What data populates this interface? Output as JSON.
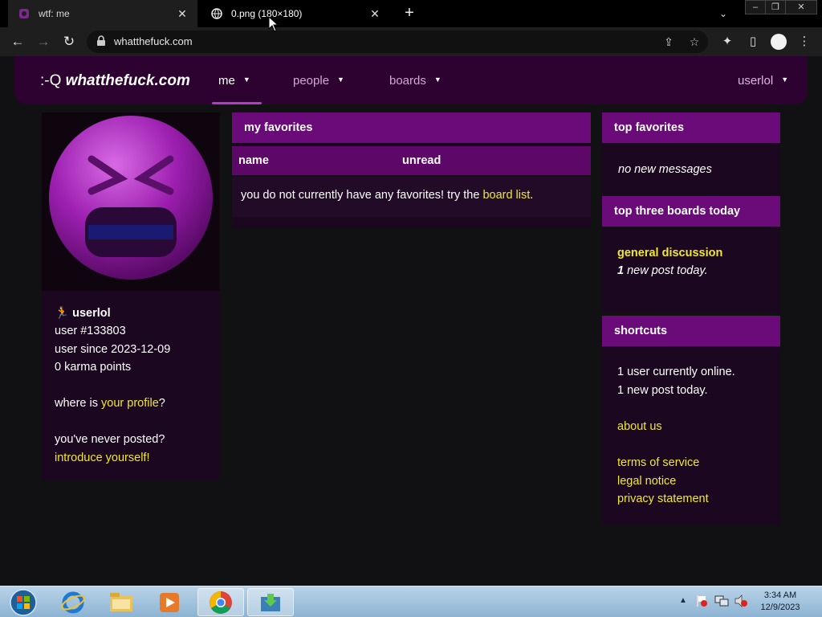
{
  "browser": {
    "tabs": [
      {
        "title": "wtf: me",
        "active": false
      },
      {
        "title": "0.png (180×180)",
        "active": true
      }
    ],
    "new_tab": "+",
    "url": "whatthefuck.com"
  },
  "site": {
    "logo_prefix": ":-Q",
    "logo_name": "whatthefuck.com",
    "nav": [
      {
        "label": "me"
      },
      {
        "label": "people"
      },
      {
        "label": "boards"
      }
    ],
    "user_menu": "userlol"
  },
  "profile": {
    "username": "userlol",
    "user_number": "user #133803",
    "user_since": "user since 2023-12-09",
    "karma": "0 karma points",
    "where_prefix": "where is ",
    "where_link": "your profile",
    "where_suffix": "?",
    "never_posted": "you've never posted?",
    "introduce_link": "introduce yourself!"
  },
  "favorites": {
    "title": "my favorites",
    "col_name": "name",
    "col_unread": "unread",
    "empty_prefix": "you do not currently have any favorites! try the ",
    "empty_link": "board list",
    "empty_suffix": "."
  },
  "top_favorites": {
    "title": "top favorites",
    "empty": "no new messages"
  },
  "top_boards": {
    "title": "top three boards today",
    "board_name": "general discussion",
    "count": "1",
    "count_suffix": " new post today."
  },
  "shortcuts": {
    "title": "shortcuts",
    "online": "1 user currently online.",
    "posts": "1 new post today.",
    "about": "about us",
    "tos": "terms of service",
    "legal": "legal notice",
    "privacy": "privacy statement"
  },
  "taskbar": {
    "time": "3:34 AM",
    "date": "12/9/2023"
  },
  "colors": {
    "header_purple": "#6b0a79",
    "nav_bg": "#2e0230",
    "link_yellow": "#f0e72e",
    "panel_bg": "#1b0820"
  }
}
